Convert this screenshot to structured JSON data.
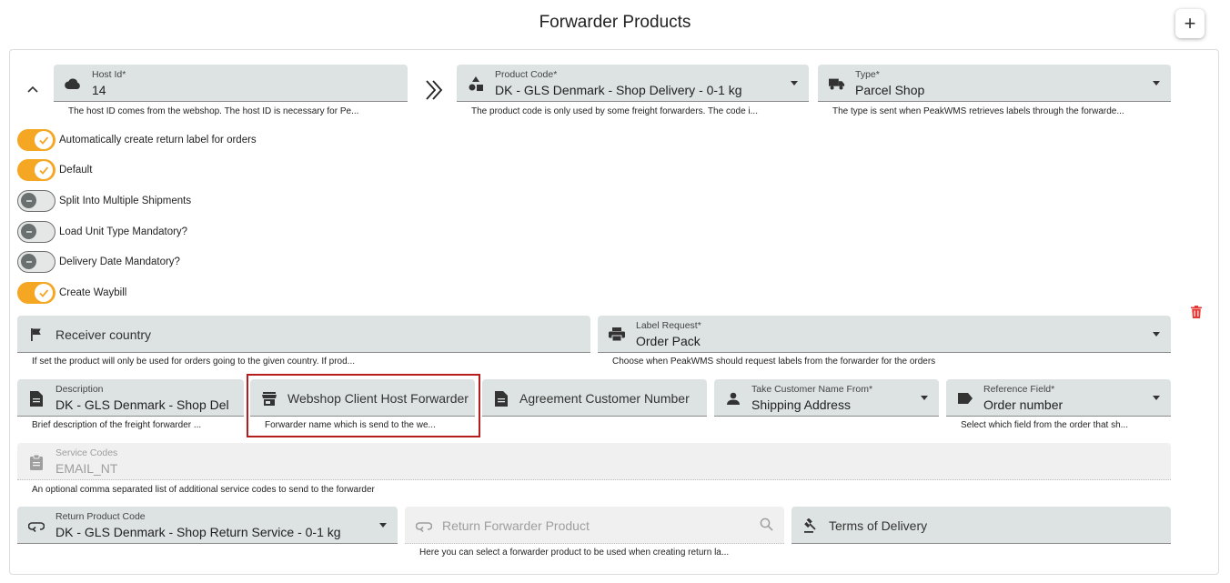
{
  "header": {
    "title": "Forwarder Products",
    "add_label": "+"
  },
  "host": {
    "label": "Host Id*",
    "value": "14",
    "hint": "The host ID comes from the webshop. The host ID is necessary for Pe..."
  },
  "product_code": {
    "label": "Product Code*",
    "value": "DK - GLS Denmark - Shop Delivery - 0-1 kg",
    "hint": "The product code is only used by some freight forwarders. The code i..."
  },
  "type": {
    "label": "Type*",
    "value": "Parcel Shop",
    "hint": "The type is sent when PeakWMS retrieves labels through the forwarde..."
  },
  "toggles": [
    {
      "label": "Automatically create return label for orders",
      "on": true
    },
    {
      "label": "Default",
      "on": true
    },
    {
      "label": "Split Into Multiple Shipments",
      "on": false
    },
    {
      "label": "Load Unit Type Mandatory?",
      "on": false
    },
    {
      "label": "Delivery Date Mandatory?",
      "on": false
    },
    {
      "label": "Create Waybill",
      "on": true
    }
  ],
  "receiver_country": {
    "placeholder": "Receiver country",
    "hint": "If set the product will only be used for orders going to the given country. If prod..."
  },
  "label_request": {
    "label": "Label Request*",
    "value": "Order Pack",
    "hint": "Choose when PeakWMS should request labels from the forwarder for the orders"
  },
  "description": {
    "label": "Description",
    "value": "DK - GLS Denmark - Shop Del",
    "hint": "Brief description of the freight forwarder ..."
  },
  "webshop_client_host_forwarder": {
    "placeholder": "Webshop Client Host Forwarder",
    "hint": "Forwarder name which is send to the we..."
  },
  "agreement_customer_number": {
    "placeholder": "Agreement Customer Number"
  },
  "take_customer_name_from": {
    "label": "Take Customer Name From*",
    "value": "Shipping Address"
  },
  "reference_field": {
    "label": "Reference Field*",
    "value": "Order number",
    "hint": "Select which field from the order that sh..."
  },
  "service_codes": {
    "label": "Service Codes",
    "value": "EMAIL_NT",
    "hint": "An optional comma separated list of additional service codes to send to the forwarder"
  },
  "return_product_code": {
    "label": "Return Product Code",
    "value": "DK - GLS Denmark - Shop Return Service - 0-1 kg"
  },
  "return_forwarder_product": {
    "placeholder": "Return Forwarder Product",
    "hint": "Here you can select a forwarder product to be used when creating return la..."
  },
  "terms_of_delivery": {
    "placeholder": "Terms of Delivery"
  },
  "colors": {
    "accent": "#f5a623",
    "field_bg": "#dde3e2",
    "delete": "#e53935",
    "highlight": "#b71c1c"
  }
}
